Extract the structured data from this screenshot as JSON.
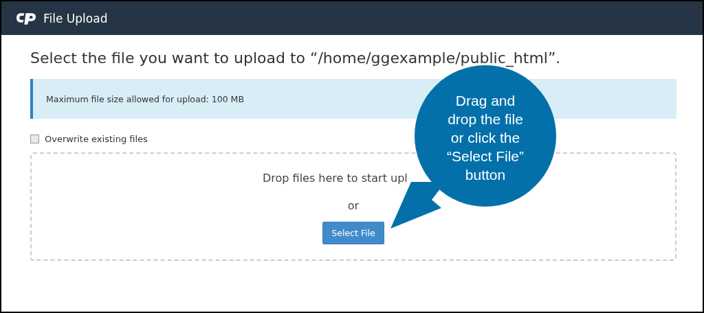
{
  "window": {
    "title": "File Upload"
  },
  "heading": "Select the file you want to upload to “/home/ggexample/public_html”.",
  "notice": "Maximum file size allowed for upload: 100 MB",
  "overwrite": {
    "label": "Overwrite existing files",
    "checked": false
  },
  "dropzone": {
    "message": "Drop files here to start upl",
    "separator": "or",
    "button": "Select File"
  },
  "callout": {
    "lines": [
      "Drag and",
      "drop the file",
      "or click the",
      "“Select File”",
      "button"
    ]
  }
}
